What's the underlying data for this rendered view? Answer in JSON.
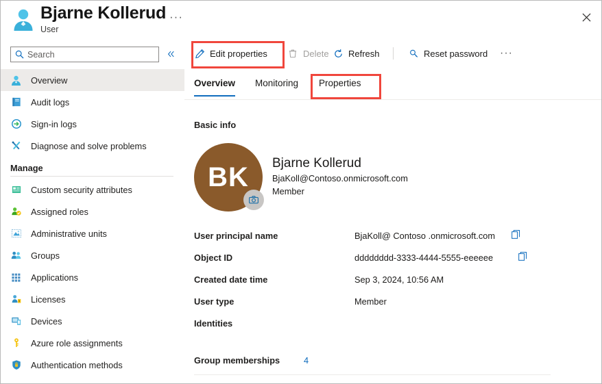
{
  "header": {
    "icon": "user-icon",
    "title": "Bjarne Kollerud",
    "subtitle": "User",
    "ellipsis": "···",
    "close_icon": "close-icon"
  },
  "sidebar": {
    "search": {
      "placeholder": "Search",
      "value": "",
      "icon": "search-icon"
    },
    "collapse_icon": "chevron-double-left-icon",
    "items": [
      {
        "label": "Overview",
        "icon": "user-icon",
        "active": true
      },
      {
        "label": "Audit logs",
        "icon": "book-icon",
        "active": false
      },
      {
        "label": "Sign-in logs",
        "icon": "sign-in-icon",
        "active": false
      },
      {
        "label": "Diagnose and solve problems",
        "icon": "wrench-screwdriver-icon",
        "active": false
      }
    ],
    "group_title": "Manage",
    "manage_items": [
      {
        "label": "Custom security attributes",
        "icon": "attribute-card-icon"
      },
      {
        "label": "Assigned roles",
        "icon": "assigned-roles-icon"
      },
      {
        "label": "Administrative units",
        "icon": "administrative-units-icon"
      },
      {
        "label": "Groups",
        "icon": "groups-icon"
      },
      {
        "label": "Applications",
        "icon": "applications-grid-icon"
      },
      {
        "label": "Licenses",
        "icon": "licenses-icon"
      },
      {
        "label": "Devices",
        "icon": "devices-icon"
      },
      {
        "label": "Azure role assignments",
        "icon": "key-icon"
      },
      {
        "label": "Authentication methods",
        "icon": "shield-lock-icon"
      }
    ]
  },
  "toolbar": {
    "commands": [
      {
        "label": "Edit properties",
        "icon": "pencil-icon",
        "disabled": false
      },
      {
        "label": "Delete",
        "icon": "trash-icon",
        "disabled": true
      },
      {
        "label": "Refresh",
        "icon": "refresh-icon",
        "disabled": false
      },
      {
        "label": "Reset password",
        "icon": "key-search-icon",
        "disabled": false
      }
    ],
    "overflow": "···"
  },
  "tabs": [
    {
      "label": "Overview",
      "active": true
    },
    {
      "label": "Monitoring",
      "active": false
    },
    {
      "label": "Properties",
      "active": false
    }
  ],
  "main": {
    "section_title": "Basic info",
    "avatar": {
      "initials": "BK",
      "color": "#8a5a2b",
      "camera_icon": "camera-icon"
    },
    "identity": {
      "name": "Bjarne Kollerud",
      "upn": "BjaKoll@Contoso.onmicrosoft.com",
      "type": "Member"
    },
    "properties": [
      {
        "label": "User principal name",
        "value": "BjaKoll@ Contoso .onmicrosoft.com",
        "copy": true
      },
      {
        "label": "Object ID",
        "value": "dddddddd-3333-4444-5555-eeeeee",
        "copy": true
      },
      {
        "label": "Created date time",
        "value": "Sep 3, 2024, 10:56 AM",
        "copy": false
      },
      {
        "label": "User type",
        "value": "Member",
        "copy": false
      },
      {
        "label": "Identities",
        "value": "",
        "copy": false
      }
    ],
    "group_memberships": {
      "label": "Group memberships",
      "count": "4"
    }
  },
  "highlights": {
    "color": "#f0463c",
    "targets": [
      "Edit properties",
      "Properties"
    ]
  }
}
